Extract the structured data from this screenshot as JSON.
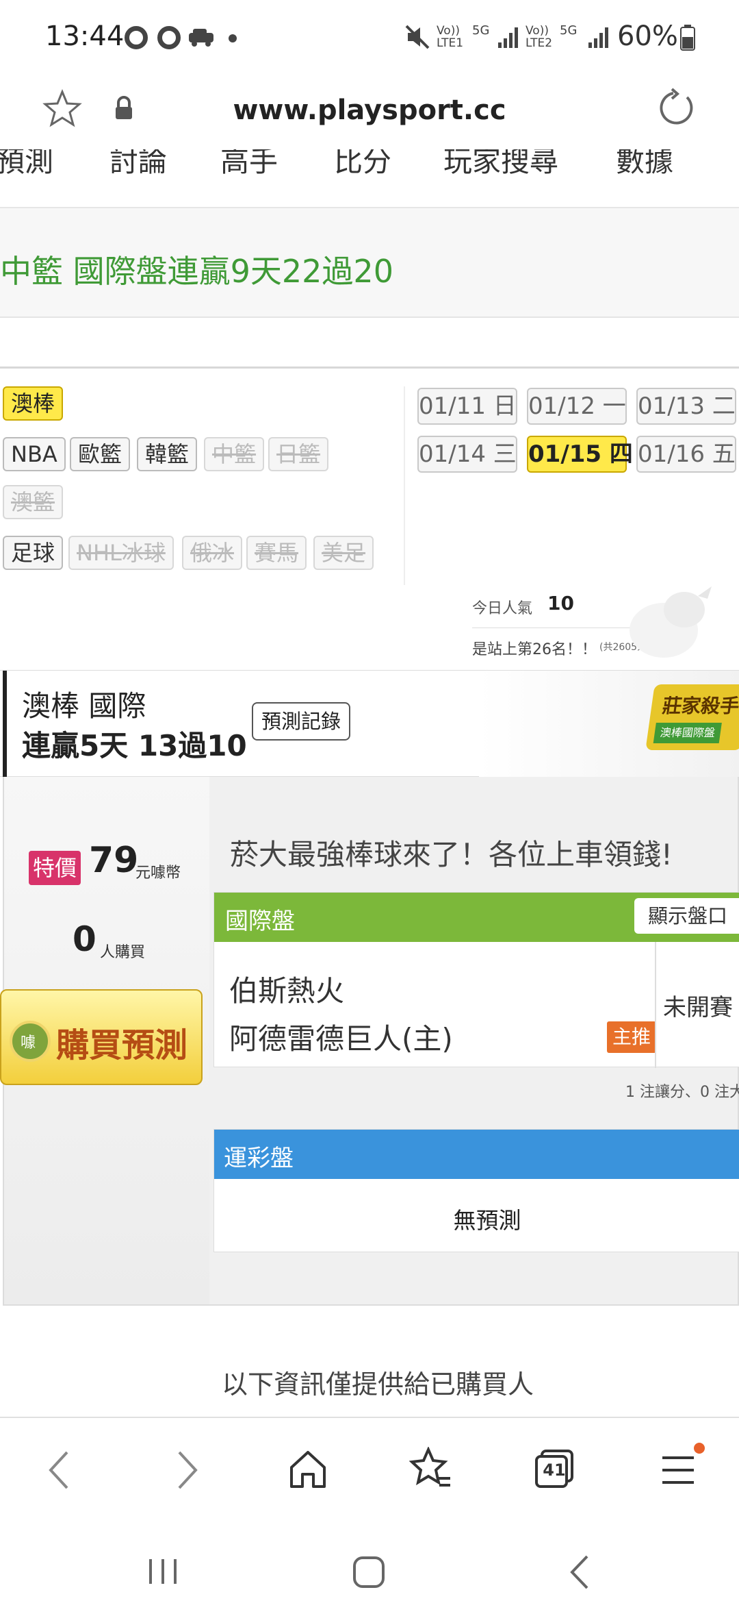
{
  "status": {
    "time": "13:44",
    "network_left": "Vo)) LTE1",
    "network_5g": "5G",
    "network_right": "Vo)) LTE2",
    "battery": "60%"
  },
  "browser": {
    "url": "www.playsport.cc"
  },
  "nav_tabs": [
    "預測",
    "討論",
    "高手",
    "比分",
    "玩家搜尋",
    "數據"
  ],
  "banner": {
    "text": "中籃 國際盤連贏9天22過20"
  },
  "sports": {
    "row1": [
      {
        "label": "澳棒",
        "state": "selected"
      }
    ],
    "row2": [
      {
        "label": "NBA",
        "state": "normal"
      },
      {
        "label": "歐籃",
        "state": "normal"
      },
      {
        "label": "韓籃",
        "state": "normal"
      },
      {
        "label": "中籃",
        "state": "disabled"
      },
      {
        "label": "日籃",
        "state": "disabled"
      }
    ],
    "row3": [
      {
        "label": "澳籃",
        "state": "disabled"
      }
    ],
    "row4": [
      {
        "label": "足球",
        "state": "normal"
      },
      {
        "label": "NHL冰球",
        "state": "disabled"
      },
      {
        "label": "俄冰",
        "state": "disabled"
      },
      {
        "label": "賽馬",
        "state": "disabled"
      },
      {
        "label": "美足",
        "state": "disabled"
      }
    ]
  },
  "dates": [
    {
      "label": "01/11 日",
      "selected": false
    },
    {
      "label": "01/12 一",
      "selected": false
    },
    {
      "label": "01/13 二",
      "selected": false
    },
    {
      "label": "01/14 三",
      "selected": false
    },
    {
      "label": "01/15 四",
      "selected": true
    },
    {
      "label": "01/16 五",
      "selected": false
    }
  ],
  "popularity": {
    "label": "今日人氣",
    "value": "10",
    "rank_text": "是站上第26名！！",
    "total": "(共2605人)"
  },
  "expert": {
    "league": "澳棒 國際",
    "streak": "連贏5天 13過10",
    "record_button": "預測記錄",
    "badge": "莊家殺手",
    "badge_sub": "澳棒國際盤"
  },
  "product": {
    "price_tag": "特價",
    "price": "79",
    "price_unit": "元噱幣",
    "buyers_count": "0",
    "buyers_label": "人購買",
    "buy_button": "購買預測",
    "buy_button_badge": "噱",
    "title": "菸大最強棒球來了！各位上車領錢!",
    "intl": {
      "header": "國際盤",
      "show_button": "顯示盤口",
      "team_away": "伯斯熱火",
      "team_home": "阿德雷德巨人(主)",
      "main_tag": "主推",
      "status": "未開賽",
      "summary": "1 注讓分、0 注大"
    },
    "sportslottery": {
      "header": "運彩盤",
      "content": "無預測"
    }
  },
  "info_text": "以下資訊僅提供給已購買人",
  "bottom_nav": {
    "tabs_count": "41"
  }
}
